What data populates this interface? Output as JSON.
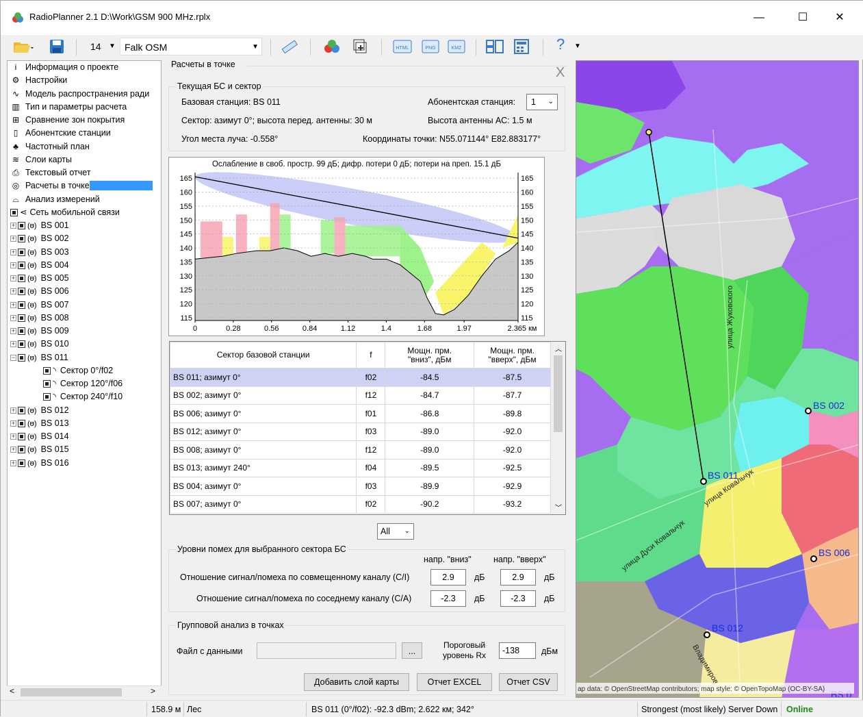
{
  "window": {
    "title": "RadioPlanner 2.1 D:\\Work\\GSM 900 MHz.rplx",
    "minimize": "—",
    "maximize": "☐",
    "close": "✕"
  },
  "toolbar": {
    "font_size": "14",
    "font_name": "Falk OSM",
    "help": "?"
  },
  "tree": {
    "items": [
      {
        "icon": "i",
        "label": "Информация о проекте"
      },
      {
        "icon": "⚙",
        "label": "Настройки"
      },
      {
        "icon": "∿",
        "label": "Модель распространения ради"
      },
      {
        "icon": "▥",
        "label": "Тип и параметры расчета"
      },
      {
        "icon": "⊞",
        "label": "Сравнение зон покрытия"
      },
      {
        "icon": "▯",
        "label": "Абонентские станции"
      },
      {
        "icon": "♣",
        "label": "Частотный план"
      },
      {
        "icon": "≋",
        "label": "Слои карты"
      },
      {
        "icon": "⎙",
        "label": "Текстовый отчет"
      },
      {
        "icon": "◎",
        "label": "Расчеты в точке"
      },
      {
        "icon": "⌓",
        "label": "Анализ измерений"
      },
      {
        "icon": "⋖",
        "label": "Сеть мобильной связи"
      }
    ],
    "stations": [
      "BS 001",
      "BS 002",
      "BS 003",
      "BS 004",
      "BS 005",
      "BS 006",
      "BS 007",
      "BS 008",
      "BS 009",
      "BS 010",
      "BS 011"
    ],
    "sectors": [
      "Сектор 0°/f02",
      "Сектор 120°/f06",
      "Сектор 240°/f10"
    ],
    "stations2": [
      "BS 012",
      "BS 013",
      "BS 014",
      "BS 015",
      "BS 016"
    ]
  },
  "panel": {
    "title": "Расчеты в точке",
    "close": "X",
    "current_group": "Текущая БС и сектор",
    "base_station": "Базовая станция: BS 011",
    "subscriber_label": "Абонентская станция:",
    "subscriber_value": "1",
    "sector": "Сектор: азимут 0°;  высота перед. антенны: 30 м",
    "ant_height": "Высота антенны АС: 1.5 м",
    "angle": "Угол места луча: -0.558°",
    "coords": "Координаты точки: N55.071144°  E82.883177°",
    "filter": "All",
    "interference_group": "Уровни помех для выбранного сектора БС",
    "dir_down": "напр. \"вниз\"",
    "dir_up": "напр. \"вверх\"",
    "ci_label": "Отношение сигнал/помеха по совмещенному каналу (C/I)",
    "ci_down": "2.9",
    "ci_up": "2.9",
    "ca_label": "Отношение сигнал/помеха по соседнему каналу (C/A)",
    "ca_down": "-2.3",
    "ca_up": "-2.3",
    "db": "дБ",
    "group_analysis": "Групповой анализ в точках",
    "file_label": "Файл с данными",
    "browse": "...",
    "threshold_label1": "Пороговый",
    "threshold_label2": "уровень Rx",
    "threshold_value": "-138",
    "dbm": "дБм",
    "btn_layer": "Добавить слой карты",
    "btn_excel": "Отчет EXCEL",
    "btn_csv": "Отчет CSV"
  },
  "table": {
    "headers": [
      "Сектор базовой станции",
      "f",
      "Мощн. прм.\n\"вниз\", дБм",
      "Мощн. прм.\n\"вверх\", дБм"
    ],
    "rows": [
      [
        "BS 011; азимут 0°",
        "f02",
        "-84.5",
        "-87.5"
      ],
      [
        "BS 002; азимут 0°",
        "f12",
        "-84.7",
        "-87.7"
      ],
      [
        "BS 006; азимут 0°",
        "f01",
        "-86.8",
        "-89.8"
      ],
      [
        "BS 012; азимут 0°",
        "f03",
        "-89.0",
        "-92.0"
      ],
      [
        "BS 008; азимут 0°",
        "f12",
        "-89.0",
        "-92.0"
      ],
      [
        "BS 013; азимут 240°",
        "f04",
        "-89.5",
        "-92.5"
      ],
      [
        "BS 004; азимут 0°",
        "f03",
        "-89.9",
        "-92.9"
      ],
      [
        "BS 007; азимут 0°",
        "f02",
        "-90.2",
        "-93.2"
      ]
    ]
  },
  "chart_data": {
    "type": "area",
    "title": "Ослабление в своб. простр. 99 дБ; дифр. потери 0 дБ; потери на преп. 15.1 дБ",
    "xlabel": "км",
    "x_ticks": [
      "0",
      "0.28",
      "0.56",
      "0.84",
      "1.12",
      "1.4",
      "1.68",
      "1.97",
      "2.365 км"
    ],
    "y_ticks": [
      115,
      120,
      125,
      130,
      135,
      140,
      145,
      150,
      155,
      160,
      165
    ],
    "ylim": [
      114,
      167
    ],
    "xlim": [
      0,
      2.365
    ],
    "terrain_x": [
      0,
      0.1,
      0.2,
      0.3,
      0.45,
      0.55,
      0.65,
      0.75,
      0.85,
      0.95,
      1.05,
      1.15,
      1.25,
      1.3,
      1.4,
      1.5,
      1.6,
      1.65,
      1.7,
      1.76,
      1.82,
      1.9,
      2.0,
      2.1,
      2.2,
      2.3,
      2.365
    ],
    "terrain_y": [
      136,
      136.5,
      137,
      138,
      139,
      139,
      140,
      139,
      137,
      138,
      137,
      138,
      137,
      136,
      136,
      134,
      130,
      128,
      122,
      116.5,
      116,
      118,
      123,
      130,
      136,
      139,
      142
    ],
    "los_line": {
      "x": [
        0,
        2.365
      ],
      "y": [
        165.5,
        143.5
      ]
    },
    "obstacles": [
      {
        "x0": 0.04,
        "x1": 0.2,
        "y": 149.5,
        "color": "#f7a5b4"
      },
      {
        "x0": 0.2,
        "x1": 0.28,
        "y": 144,
        "color": "#f8f56a"
      },
      {
        "x0": 0.3,
        "x1": 0.38,
        "y": 152,
        "color": "#f7a5b4"
      },
      {
        "x0": 0.47,
        "x1": 0.55,
        "y": 144,
        "color": "#f8f56a"
      },
      {
        "x0": 0.55,
        "x1": 0.62,
        "y": 156,
        "color": "#f7a5b4"
      },
      {
        "x0": 0.62,
        "x1": 0.7,
        "y": 152,
        "color": "#9ef28a"
      },
      {
        "x0": 0.92,
        "x1": 1.02,
        "y": 150,
        "color": "#9ef28a"
      },
      {
        "x0": 1.02,
        "x1": 1.1,
        "y": 151,
        "color": "#f7a5b4"
      },
      {
        "x0": 1.1,
        "x1": 1.5,
        "y": 148,
        "color": "#9ef28a"
      }
    ]
  },
  "map": {
    "attribution": "ap data: © OpenStreetMap contributors; map style: © OpenTopoMap (OC-BY-SA)",
    "labels": [
      {
        "text": "BS 002"
      },
      {
        "text": "BS 011"
      },
      {
        "text": "BS 006"
      },
      {
        "text": "BS 012"
      },
      {
        "text": "BS 0"
      }
    ],
    "streets": [
      "улица Жуковского",
      "улица Ковальчук",
      "улица Дуси Ковальчук",
      "Владимиров"
    ]
  },
  "status": {
    "elev": "158.9 м",
    "cover": "Лес",
    "info": "BS 011 (0°/f02): -92.3 dBm; 2.622 км; 342°",
    "mode": "Strongest (most likely) Server Down",
    "online": "Online"
  }
}
